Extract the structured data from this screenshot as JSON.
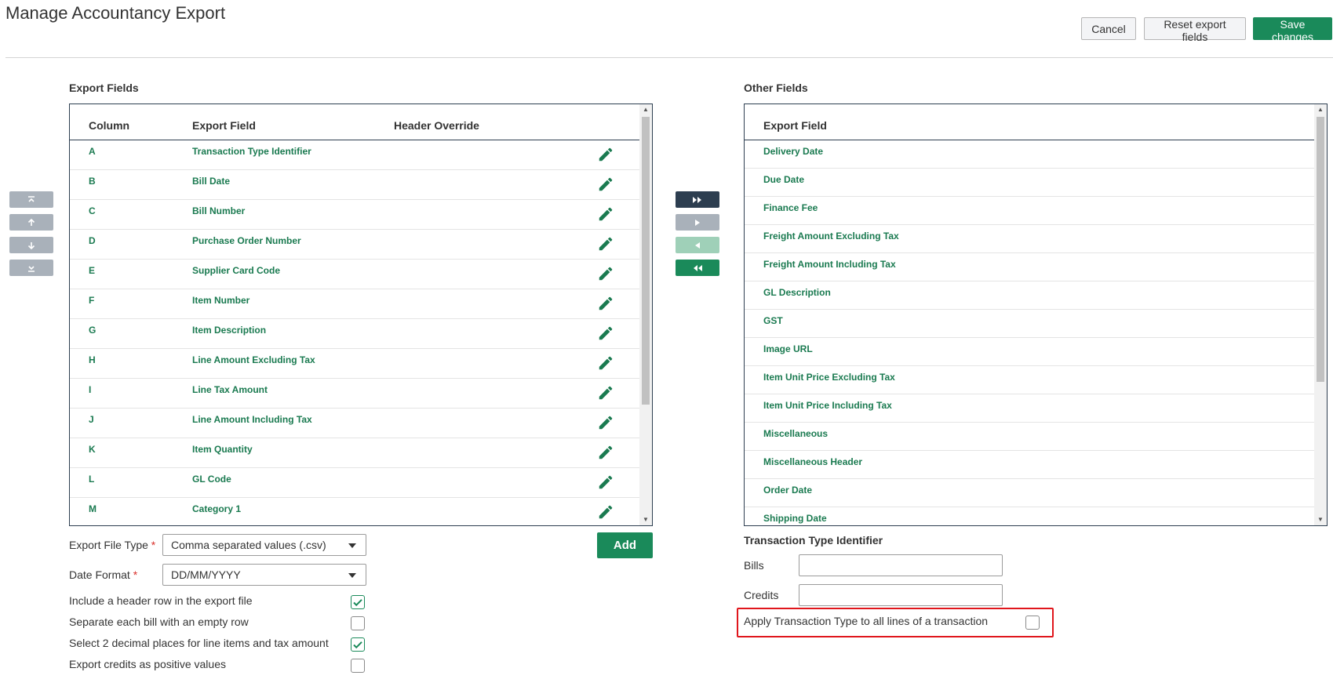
{
  "page": {
    "title": "Manage Accountancy Export"
  },
  "toolbar": {
    "cancel": "Cancel",
    "reset": "Reset export fields",
    "save": "Save changes"
  },
  "export_fields": {
    "heading": "Export Fields",
    "columns": [
      "Column",
      "Export Field",
      "Header Override"
    ],
    "rows": [
      {
        "col": "A",
        "field": "Transaction Type Identifier"
      },
      {
        "col": "B",
        "field": "Bill Date"
      },
      {
        "col": "C",
        "field": "Bill Number"
      },
      {
        "col": "D",
        "field": "Purchase Order Number"
      },
      {
        "col": "E",
        "field": "Supplier Card Code"
      },
      {
        "col": "F",
        "field": "Item Number"
      },
      {
        "col": "G",
        "field": "Item Description"
      },
      {
        "col": "H",
        "field": "Line Amount Excluding Tax"
      },
      {
        "col": "I",
        "field": "Line Tax Amount"
      },
      {
        "col": "J",
        "field": "Line Amount Including Tax"
      },
      {
        "col": "K",
        "field": "Item Quantity"
      },
      {
        "col": "L",
        "field": "GL Code"
      },
      {
        "col": "M",
        "field": "Category 1"
      }
    ],
    "add_label": "Add"
  },
  "other_fields": {
    "heading": "Other Fields",
    "column": "Export Field",
    "rows": [
      "Delivery Date",
      "Due Date",
      "Finance Fee",
      "Freight Amount Excluding Tax",
      "Freight Amount Including Tax",
      "GL Description",
      "GST",
      "Image URL",
      "Item Unit Price Excluding Tax",
      "Item Unit Price Including Tax",
      "Miscellaneous",
      "Miscellaneous Header",
      "Order Date",
      "Shipping Date"
    ]
  },
  "settings": {
    "file_type_label": "Export File Type",
    "file_type_value": "Comma separated values (.csv)",
    "date_format_label": "Date Format",
    "date_format_value": "DD/MM/YYYY",
    "required_mark": "*",
    "options": [
      {
        "label": "Include a header row in the export file",
        "checked": true
      },
      {
        "label": "Separate each bill with an empty row",
        "checked": false
      },
      {
        "label": "Select 2 decimal places for line items and tax amount",
        "checked": true
      },
      {
        "label": "Export credits as positive values",
        "checked": false
      }
    ]
  },
  "transaction_type": {
    "heading": "Transaction Type Identifier",
    "bills_label": "Bills",
    "bills_value": "",
    "credits_label": "Credits",
    "credits_value": "",
    "apply_all_label": "Apply Transaction Type to all lines of a transaction",
    "apply_all_checked": false
  },
  "colors": {
    "accent_green": "#1a8a5a",
    "link_green": "#1a7a50",
    "navy": "#2d3e50",
    "highlight_red": "#e0161c"
  },
  "icons": {
    "order": [
      "move-to-top-icon",
      "move-up-icon",
      "move-down-icon",
      "move-to-bottom-icon"
    ],
    "transfer": [
      "move-all-right-icon",
      "move-right-icon",
      "move-left-icon",
      "move-all-left-icon"
    ],
    "edit": "pencil-icon",
    "check": "check-icon"
  }
}
